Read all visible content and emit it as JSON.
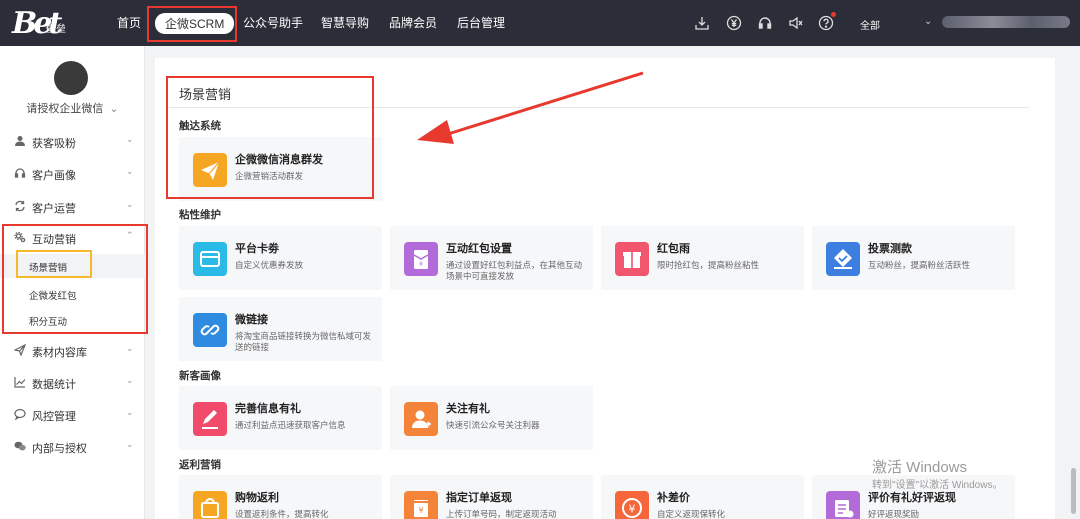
{
  "header": {
    "logo_mark": "Bet",
    "logo_sub": "壁垒",
    "nav": [
      {
        "label": "首页"
      },
      {
        "label": "企微SCRM",
        "active": true
      },
      {
        "label": "公众号助手"
      },
      {
        "label": "智慧导购"
      },
      {
        "label": "品牌会员"
      },
      {
        "label": "后台管理"
      }
    ],
    "icons": [
      "download-icon",
      "yuan-circle-icon",
      "headset-icon",
      "speaker-icon",
      "help-icon"
    ],
    "scope_label": "全部"
  },
  "sidebar": {
    "company": "请授权企业微信",
    "items": [
      {
        "label": "获客吸粉",
        "icon": "user-icon"
      },
      {
        "label": "客户画像",
        "icon": "headphone-icon"
      },
      {
        "label": "客户运营",
        "icon": "refresh-icon"
      },
      {
        "label": "互动营销",
        "icon": "gear-icon",
        "expanded": true,
        "children": [
          {
            "label": "场景营销",
            "active": true
          },
          {
            "label": "企微发红包"
          },
          {
            "label": "积分互动"
          }
        ]
      },
      {
        "label": "素材内容库",
        "icon": "send-icon"
      },
      {
        "label": "数据统计",
        "icon": "chart-icon"
      },
      {
        "label": "风控管理",
        "icon": "chat-bubble-icon"
      },
      {
        "label": "内部与授权",
        "icon": "wechat-icon"
      }
    ]
  },
  "main": {
    "title": "场景营销",
    "sections": [
      {
        "label": "触达系统",
        "cards": [
          {
            "title": "企微微信消息群发",
            "desc": "企微营销活动群发",
            "icon": "paper-plane-icon",
            "color": "#f5a623"
          }
        ]
      },
      {
        "label": "粘性维护",
        "cards": [
          {
            "title": "平台卡劵",
            "desc": "自定义优惠券发放",
            "icon": "card-icon",
            "color": "#2bb9e6"
          },
          {
            "title": "互动红包设置",
            "desc": "通过设置好红包利益点，在其他互动场景中可直接发放",
            "icon": "red-packet-icon",
            "color": "#b26bd9"
          },
          {
            "title": "红包雨",
            "desc": "限时抢红包，提高粉丝粘性",
            "icon": "gift-icon",
            "color": "#f2566e"
          },
          {
            "title": "投票测款",
            "desc": "互动粉丝，提高粉丝活跃性",
            "icon": "vote-icon",
            "color": "#3d7fe0"
          },
          {
            "title": "微链接",
            "desc": "将淘宝商品链接转换为微信私域可发送的链接",
            "icon": "link-icon",
            "color": "#2f8be0"
          }
        ]
      },
      {
        "label": "新客画像",
        "cards": [
          {
            "title": "完善信息有礼",
            "desc": "通过利益点迅速获取客户信息",
            "icon": "edit-icon",
            "color": "#f04b6b"
          },
          {
            "title": "关注有礼",
            "desc": "快速引流公众号关注利器",
            "icon": "follow-user-icon",
            "color": "#f5843b"
          }
        ]
      },
      {
        "label": "返利营销",
        "cards": [
          {
            "title": "购物返利",
            "desc": "设置返利条件，提高转化",
            "icon": "shopping-bag-icon",
            "color": "#f5a623"
          },
          {
            "title": "指定订单返现",
            "desc": "上传订单号码，制定返现活动",
            "icon": "order-icon",
            "color": "#f5843b"
          },
          {
            "title": "补差价",
            "desc": "自定义返现保转化",
            "icon": "yuan-icon",
            "color": "#f5663b"
          },
          {
            "title": "评价有礼好评返现",
            "desc": "好评返现奖励",
            "icon": "review-icon",
            "color": "#b26bd9"
          }
        ]
      }
    ]
  },
  "watermark": {
    "line1": "激活 Windows",
    "line2": "转到\"设置\"以激活 Windows。"
  },
  "annotations": {
    "highlight_color": "#e8392f",
    "submenu_highlight_color": "#f5b92d"
  }
}
